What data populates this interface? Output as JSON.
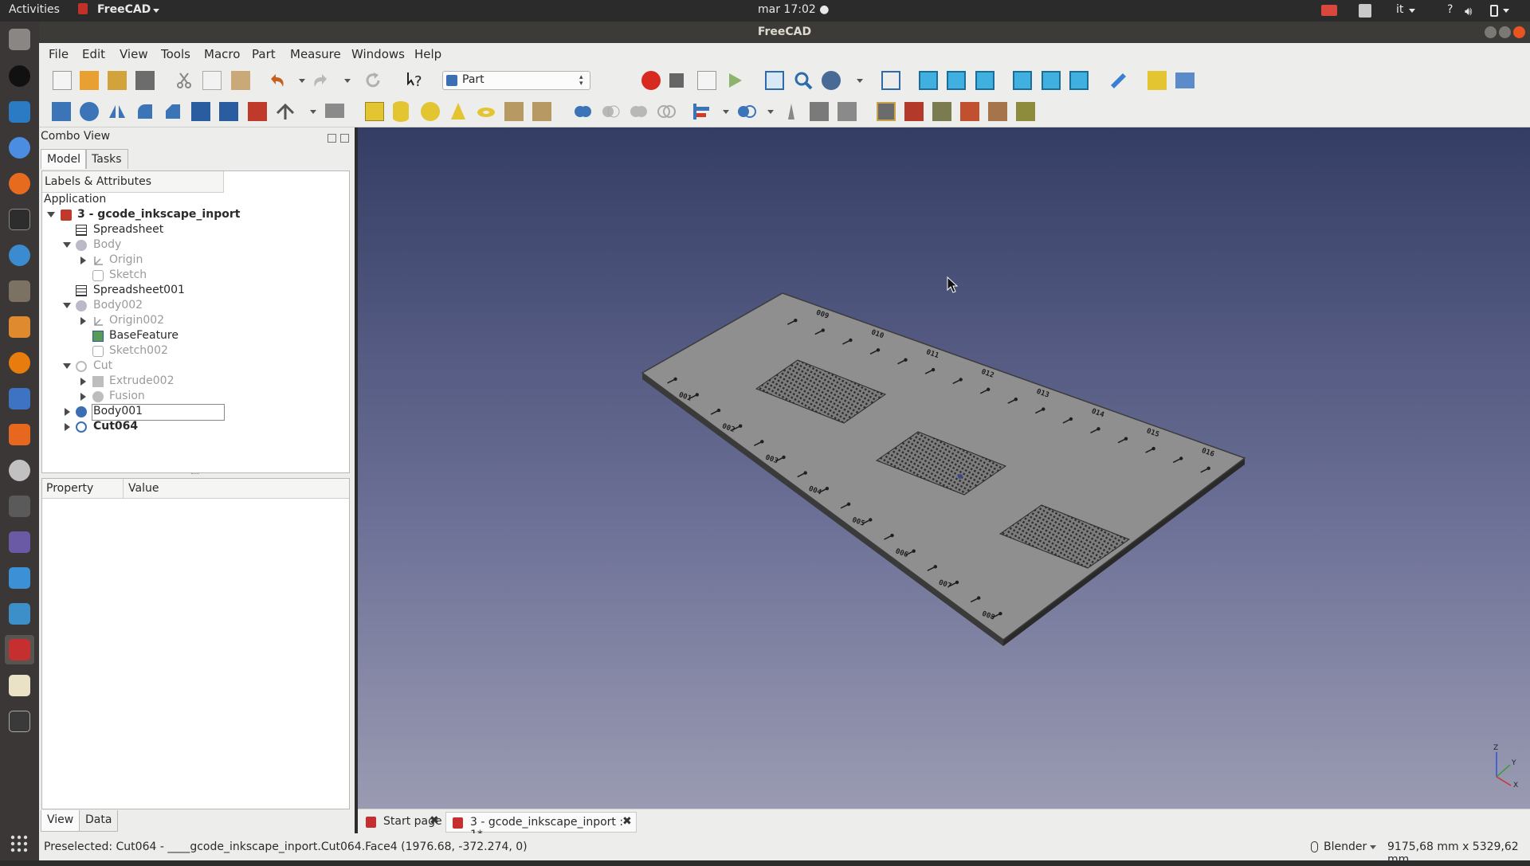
{
  "topbar": {
    "activities": "Activities",
    "app_name": "FreeCAD",
    "clock": "mar 17:02 ●",
    "lang": "it",
    "help": "?"
  },
  "window": {
    "title": "FreeCAD"
  },
  "menu": [
    "File",
    "Edit",
    "View",
    "Tools",
    "Macro",
    "Part",
    "Measure",
    "Windows",
    "Help"
  ],
  "workbench": {
    "selected": "Part"
  },
  "combo": {
    "title": "Combo View",
    "tabs": [
      "Model",
      "Tasks"
    ],
    "tree_header": "Labels & Attributes",
    "root_label": "Application",
    "items": [
      {
        "label": "3 - gcode_inkscape_inport"
      },
      {
        "label": "Spreadsheet"
      },
      {
        "label": "Body"
      },
      {
        "label": "Origin"
      },
      {
        "label": "Sketch"
      },
      {
        "label": "Spreadsheet001"
      },
      {
        "label": "Body002"
      },
      {
        "label": "Origin002"
      },
      {
        "label": "BaseFeature"
      },
      {
        "label": "Sketch002"
      },
      {
        "label": "Cut"
      },
      {
        "label": "Extrude002"
      },
      {
        "label": "Fusion"
      },
      {
        "label": "Body001"
      },
      {
        "label": "Cut064"
      }
    ],
    "property_headers": [
      "Property",
      "Value"
    ],
    "bottom_tabs": [
      "View",
      "Data"
    ]
  },
  "view3d": {
    "plate_numbers_left": [
      "001",
      "002",
      "003",
      "004",
      "005",
      "006",
      "007",
      "008"
    ],
    "plate_numbers_right": [
      "009",
      "010",
      "011",
      "012",
      "013",
      "014",
      "015",
      "016"
    ],
    "axis": {
      "z": "Z",
      "y": "Y",
      "x": "X"
    }
  },
  "doc_tabs": [
    "Start page",
    "3 - gcode_inkscape_inport : 1*"
  ],
  "status": {
    "message": "Preselected: Cut064 - ____gcode_inkscape_inport.Cut064.Face4 (1976.68, -372.274, 0)",
    "nav_style": "Blender",
    "dimensions": "9175,68 mm x 5329,62 mm"
  },
  "colors": {
    "view_top": "#343d64",
    "view_bottom": "#9a9bb2",
    "accent": "#e95420"
  }
}
